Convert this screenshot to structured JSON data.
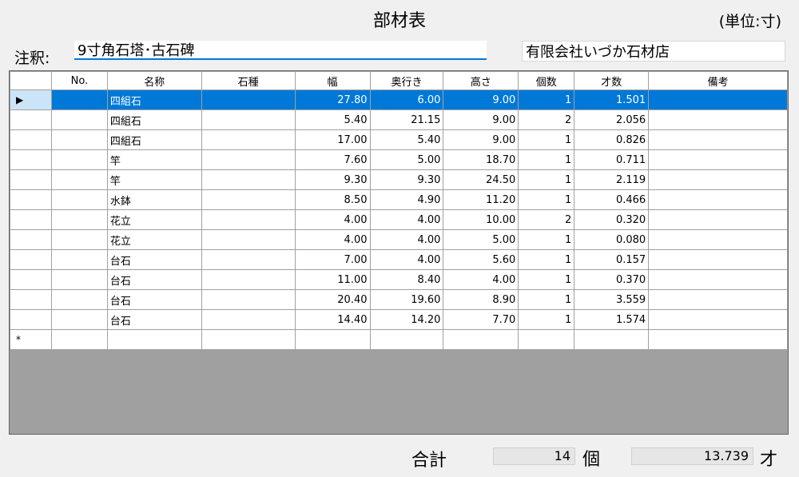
{
  "header": {
    "title": "部材表",
    "unit_label": "(単位:寸)"
  },
  "note": {
    "label": "注釈:",
    "value": "9寸角石塔･古石碑"
  },
  "company": {
    "value": "有限会社いづか石材店"
  },
  "grid": {
    "columns": [
      "No.",
      "名称",
      "石種",
      "幅",
      "奥行き",
      "高さ",
      "個数",
      "才数",
      "備考"
    ],
    "selected_row_marker": "▶",
    "new_row_marker": "*",
    "rows": [
      {
        "no": "",
        "name": "四組石",
        "stone": "",
        "width": "27.80",
        "depth": "6.00",
        "height": "9.00",
        "count": "1",
        "sai": "1.501",
        "remarks": ""
      },
      {
        "no": "",
        "name": "四組石",
        "stone": "",
        "width": "5.40",
        "depth": "21.15",
        "height": "9.00",
        "count": "2",
        "sai": "2.056",
        "remarks": ""
      },
      {
        "no": "",
        "name": "四組石",
        "stone": "",
        "width": "17.00",
        "depth": "5.40",
        "height": "9.00",
        "count": "1",
        "sai": "0.826",
        "remarks": ""
      },
      {
        "no": "",
        "name": "竿",
        "stone": "",
        "width": "7.60",
        "depth": "5.00",
        "height": "18.70",
        "count": "1",
        "sai": "0.711",
        "remarks": ""
      },
      {
        "no": "",
        "name": "竿",
        "stone": "",
        "width": "9.30",
        "depth": "9.30",
        "height": "24.50",
        "count": "1",
        "sai": "2.119",
        "remarks": ""
      },
      {
        "no": "",
        "name": "水鉢",
        "stone": "",
        "width": "8.50",
        "depth": "4.90",
        "height": "11.20",
        "count": "1",
        "sai": "0.466",
        "remarks": ""
      },
      {
        "no": "",
        "name": "花立",
        "stone": "",
        "width": "4.00",
        "depth": "4.00",
        "height": "10.00",
        "count": "2",
        "sai": "0.320",
        "remarks": ""
      },
      {
        "no": "",
        "name": "花立",
        "stone": "",
        "width": "4.00",
        "depth": "4.00",
        "height": "5.00",
        "count": "1",
        "sai": "0.080",
        "remarks": ""
      },
      {
        "no": "",
        "name": "台石",
        "stone": "",
        "width": "7.00",
        "depth": "4.00",
        "height": "5.60",
        "count": "1",
        "sai": "0.157",
        "remarks": ""
      },
      {
        "no": "",
        "name": "台石",
        "stone": "",
        "width": "11.00",
        "depth": "8.40",
        "height": "4.00",
        "count": "1",
        "sai": "0.370",
        "remarks": ""
      },
      {
        "no": "",
        "name": "台石",
        "stone": "",
        "width": "20.40",
        "depth": "19.60",
        "height": "8.90",
        "count": "1",
        "sai": "3.559",
        "remarks": ""
      },
      {
        "no": "",
        "name": "台石",
        "stone": "",
        "width": "14.40",
        "depth": "14.20",
        "height": "7.70",
        "count": "1",
        "sai": "1.574",
        "remarks": ""
      }
    ]
  },
  "footer": {
    "sum_label": "合計",
    "count_value": "14",
    "count_unit": "個",
    "total_value": "13.739",
    "total_unit": "才"
  },
  "colors": {
    "selection": "#0078d7",
    "row_header_selected": "#cce4f7",
    "grid_background": "#a0a0a0"
  }
}
